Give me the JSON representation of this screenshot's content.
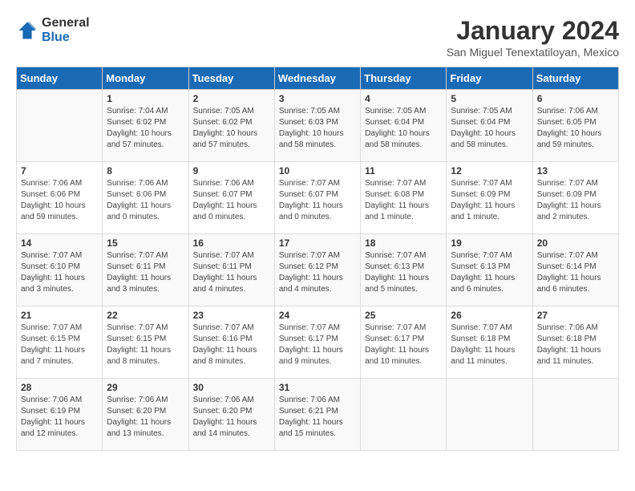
{
  "header": {
    "logo_general": "General",
    "logo_blue": "Blue",
    "month_year": "January 2024",
    "location": "San Miguel Tenextatiloyan, Mexico"
  },
  "days_of_week": [
    "Sunday",
    "Monday",
    "Tuesday",
    "Wednesday",
    "Thursday",
    "Friday",
    "Saturday"
  ],
  "weeks": [
    [
      {
        "day": "",
        "info": ""
      },
      {
        "day": "1",
        "info": "Sunrise: 7:04 AM\nSunset: 6:02 PM\nDaylight: 10 hours\nand 57 minutes."
      },
      {
        "day": "2",
        "info": "Sunrise: 7:05 AM\nSunset: 6:02 PM\nDaylight: 10 hours\nand 57 minutes."
      },
      {
        "day": "3",
        "info": "Sunrise: 7:05 AM\nSunset: 6:03 PM\nDaylight: 10 hours\nand 58 minutes."
      },
      {
        "day": "4",
        "info": "Sunrise: 7:05 AM\nSunset: 6:04 PM\nDaylight: 10 hours\nand 58 minutes."
      },
      {
        "day": "5",
        "info": "Sunrise: 7:05 AM\nSunset: 6:04 PM\nDaylight: 10 hours\nand 58 minutes."
      },
      {
        "day": "6",
        "info": "Sunrise: 7:06 AM\nSunset: 6:05 PM\nDaylight: 10 hours\nand 59 minutes."
      }
    ],
    [
      {
        "day": "7",
        "info": "Sunrise: 7:06 AM\nSunset: 6:06 PM\nDaylight: 10 hours\nand 59 minutes."
      },
      {
        "day": "8",
        "info": "Sunrise: 7:06 AM\nSunset: 6:06 PM\nDaylight: 11 hours\nand 0 minutes."
      },
      {
        "day": "9",
        "info": "Sunrise: 7:06 AM\nSunset: 6:07 PM\nDaylight: 11 hours\nand 0 minutes."
      },
      {
        "day": "10",
        "info": "Sunrise: 7:07 AM\nSunset: 6:07 PM\nDaylight: 11 hours\nand 0 minutes."
      },
      {
        "day": "11",
        "info": "Sunrise: 7:07 AM\nSunset: 6:08 PM\nDaylight: 11 hours\nand 1 minute."
      },
      {
        "day": "12",
        "info": "Sunrise: 7:07 AM\nSunset: 6:09 PM\nDaylight: 11 hours\nand 1 minute."
      },
      {
        "day": "13",
        "info": "Sunrise: 7:07 AM\nSunset: 6:09 PM\nDaylight: 11 hours\nand 2 minutes."
      }
    ],
    [
      {
        "day": "14",
        "info": "Sunrise: 7:07 AM\nSunset: 6:10 PM\nDaylight: 11 hours\nand 3 minutes."
      },
      {
        "day": "15",
        "info": "Sunrise: 7:07 AM\nSunset: 6:11 PM\nDaylight: 11 hours\nand 3 minutes."
      },
      {
        "day": "16",
        "info": "Sunrise: 7:07 AM\nSunset: 6:11 PM\nDaylight: 11 hours\nand 4 minutes."
      },
      {
        "day": "17",
        "info": "Sunrise: 7:07 AM\nSunset: 6:12 PM\nDaylight: 11 hours\nand 4 minutes."
      },
      {
        "day": "18",
        "info": "Sunrise: 7:07 AM\nSunset: 6:13 PM\nDaylight: 11 hours\nand 5 minutes."
      },
      {
        "day": "19",
        "info": "Sunrise: 7:07 AM\nSunset: 6:13 PM\nDaylight: 11 hours\nand 6 minutes."
      },
      {
        "day": "20",
        "info": "Sunrise: 7:07 AM\nSunset: 6:14 PM\nDaylight: 11 hours\nand 6 minutes."
      }
    ],
    [
      {
        "day": "21",
        "info": "Sunrise: 7:07 AM\nSunset: 6:15 PM\nDaylight: 11 hours\nand 7 minutes."
      },
      {
        "day": "22",
        "info": "Sunrise: 7:07 AM\nSunset: 6:15 PM\nDaylight: 11 hours\nand 8 minutes."
      },
      {
        "day": "23",
        "info": "Sunrise: 7:07 AM\nSunset: 6:16 PM\nDaylight: 11 hours\nand 8 minutes."
      },
      {
        "day": "24",
        "info": "Sunrise: 7:07 AM\nSunset: 6:17 PM\nDaylight: 11 hours\nand 9 minutes."
      },
      {
        "day": "25",
        "info": "Sunrise: 7:07 AM\nSunset: 6:17 PM\nDaylight: 11 hours\nand 10 minutes."
      },
      {
        "day": "26",
        "info": "Sunrise: 7:07 AM\nSunset: 6:18 PM\nDaylight: 11 hours\nand 11 minutes."
      },
      {
        "day": "27",
        "info": "Sunrise: 7:06 AM\nSunset: 6:18 PM\nDaylight: 11 hours\nand 11 minutes."
      }
    ],
    [
      {
        "day": "28",
        "info": "Sunrise: 7:06 AM\nSunset: 6:19 PM\nDaylight: 11 hours\nand 12 minutes."
      },
      {
        "day": "29",
        "info": "Sunrise: 7:06 AM\nSunset: 6:20 PM\nDaylight: 11 hours\nand 13 minutes."
      },
      {
        "day": "30",
        "info": "Sunrise: 7:06 AM\nSunset: 6:20 PM\nDaylight: 11 hours\nand 14 minutes."
      },
      {
        "day": "31",
        "info": "Sunrise: 7:06 AM\nSunset: 6:21 PM\nDaylight: 11 hours\nand 15 minutes."
      },
      {
        "day": "",
        "info": ""
      },
      {
        "day": "",
        "info": ""
      },
      {
        "day": "",
        "info": ""
      }
    ]
  ]
}
